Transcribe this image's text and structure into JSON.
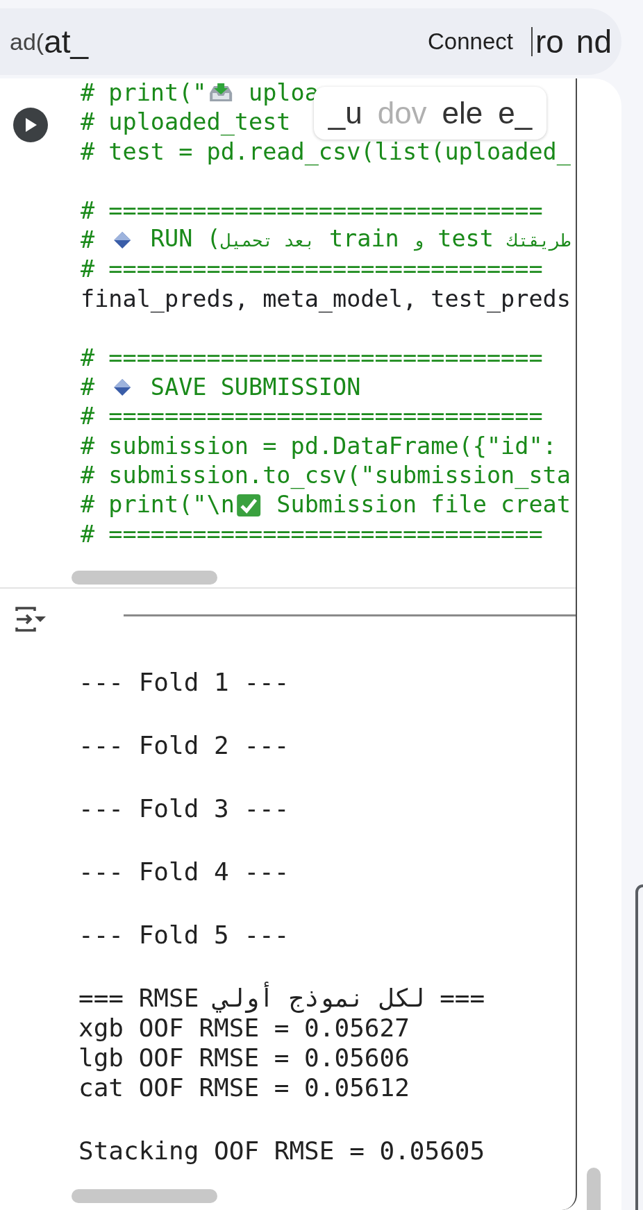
{
  "top_bar": {
    "left_faded": "ad(",
    "left": "at_",
    "connect": "Connect",
    "right": [
      "ro",
      "nd"
    ]
  },
  "code_cell": {
    "tooltip": {
      "parts": [
        {
          "text": "_u",
          "faded": false
        },
        {
          "text": "dov",
          "faded": true
        },
        {
          "text": "ele",
          "faded": false
        },
        {
          "text": "e_",
          "faded": false
        }
      ]
    },
    "lines": [
      {
        "kind": "tray",
        "parts": [
          "# print(\"",
          "uploa"
        ]
      },
      {
        "kind": "comment",
        "text": "# uploaded_test"
      },
      {
        "kind": "comment",
        "text": "# test = pd.read_csv(list(uploaded_"
      },
      {
        "kind": "blank"
      },
      {
        "kind": "comment",
        "text": "# ==============================="
      },
      {
        "kind": "diamond",
        "parts": [
          "# ",
          "RUN (بعد تحميل train و test طريقتك"
        ]
      },
      {
        "kind": "comment",
        "text": "# ==============================="
      },
      {
        "kind": "code",
        "text": "final_preds, meta_model, test_preds"
      },
      {
        "kind": "blank"
      },
      {
        "kind": "comment",
        "text": "# ==============================="
      },
      {
        "kind": "diamond",
        "parts": [
          "# ",
          "SAVE SUBMISSION"
        ]
      },
      {
        "kind": "comment",
        "text": "# ==============================="
      },
      {
        "kind": "comment",
        "text": "# submission = pd.DataFrame({\"id\":"
      },
      {
        "kind": "comment",
        "text": "# submission.to_csv(\"submission_sta"
      },
      {
        "kind": "check",
        "parts": [
          "# print(\"\\n",
          "Submission file creat"
        ]
      },
      {
        "kind": "comment",
        "text": "# ==============================="
      }
    ]
  },
  "output": {
    "lines": [
      {
        "kind": "text",
        "text": "--- Fold 1 ---"
      },
      {
        "kind": "blank"
      },
      {
        "kind": "text",
        "text": "--- Fold 2 ---"
      },
      {
        "kind": "blank"
      },
      {
        "kind": "text",
        "text": "--- Fold 3 ---"
      },
      {
        "kind": "blank"
      },
      {
        "kind": "text",
        "text": "--- Fold 4 ---"
      },
      {
        "kind": "blank"
      },
      {
        "kind": "text",
        "text": "--- Fold 5 ---"
      },
      {
        "kind": "blank"
      },
      {
        "kind": "text",
        "text": "=== RMSE لكل نموذج أولي ==="
      },
      {
        "kind": "text",
        "text": "xgb OOF RMSE = 0.05627"
      },
      {
        "kind": "text",
        "text": "lgb OOF RMSE = 0.05606"
      },
      {
        "kind": "text",
        "text": "cat OOF RMSE = 0.05612"
      },
      {
        "kind": "blank"
      },
      {
        "kind": "text",
        "text": "Stacking OOF RMSE = 0.05605"
      }
    ]
  }
}
